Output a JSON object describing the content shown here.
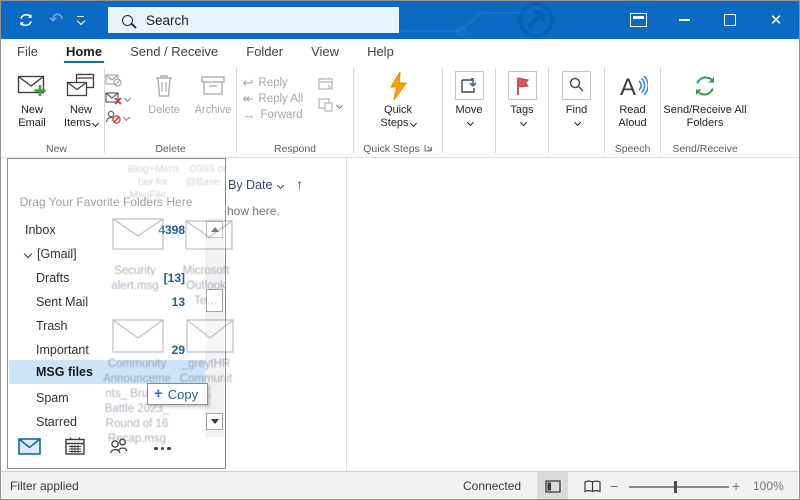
{
  "titlebar": {
    "search_placeholder": "Search",
    "icons": {
      "sync": "sync-icon",
      "undo": "undo-icon",
      "customize": "chevron-down-icon",
      "dock": "window-dock-icon",
      "minimize": "minimize-icon",
      "maximize": "maximize-icon",
      "close": "close-icon"
    }
  },
  "menu": {
    "tabs": [
      {
        "label": "File"
      },
      {
        "label": "Home",
        "active": true
      },
      {
        "label": "Send / Receive"
      },
      {
        "label": "Folder"
      },
      {
        "label": "View"
      },
      {
        "label": "Help"
      }
    ]
  },
  "ribbon": {
    "groups": {
      "new": {
        "label": "New",
        "new_email": "New Email",
        "new_items": "New Items"
      },
      "delete": {
        "label": "Delete",
        "delete_btn": "Delete",
        "archive_btn": "Archive"
      },
      "respond": {
        "label": "Respond",
        "reply": "Reply",
        "reply_all": "Reply All",
        "forward": "Forward"
      },
      "quick_steps": {
        "label": "Quick Steps",
        "button": "Quick Steps"
      },
      "move": {
        "button": "Move"
      },
      "tags": {
        "button": "Tags"
      },
      "find": {
        "button": "Find"
      },
      "speech": {
        "label": "Speech",
        "read_aloud": "Read Aloud"
      },
      "send_receive": {
        "label": "Send/Receive",
        "button": "Send/Receive All Folders"
      }
    }
  },
  "folder_pane": {
    "hint": "Drag Your Favorite Folders Here",
    "folders": [
      {
        "name": "Inbox",
        "count": "4398"
      },
      {
        "name": "[Gmail]",
        "expanded": true
      },
      {
        "name": "Drafts",
        "count": "[13]"
      },
      {
        "name": "Sent Mail",
        "count": "13"
      },
      {
        "name": "Trash"
      },
      {
        "name": "Important",
        "count": "29"
      },
      {
        "name": "MSG files",
        "selected": true
      },
      {
        "name": "Spam"
      },
      {
        "name": "Starred"
      }
    ]
  },
  "message_list": {
    "sort_label": "By Date",
    "empty_text_fragment": "how here."
  },
  "drag_ghost": {
    "items": [
      {
        "name": "Blog+Member for MsgFile…"
      },
      {
        "name": "O365 or @Base…"
      },
      {
        "name": "Security alert.msg"
      },
      {
        "name": "Microsoft Outlook Te…"
      },
      {
        "name": "Community Announcements_ Brussel Battle 2023_ Round of 16 Recap.msg"
      },
      {
        "name": "_greytHR Communit…"
      }
    ],
    "tooltip_label": "Copy"
  },
  "status_bar": {
    "left": "Filter applied",
    "connection": "Connected",
    "zoom_level": "100%"
  },
  "colors": {
    "titlebar_blue": "#0b6ac3",
    "accent_blue": "#0f6cbd",
    "selection_highlight": "#cce4f7",
    "count_blue": "#1e5c9e",
    "flag_red": "#e8434b",
    "bolt_orange": "#f6a500",
    "sync_green": "#2e9e44"
  }
}
